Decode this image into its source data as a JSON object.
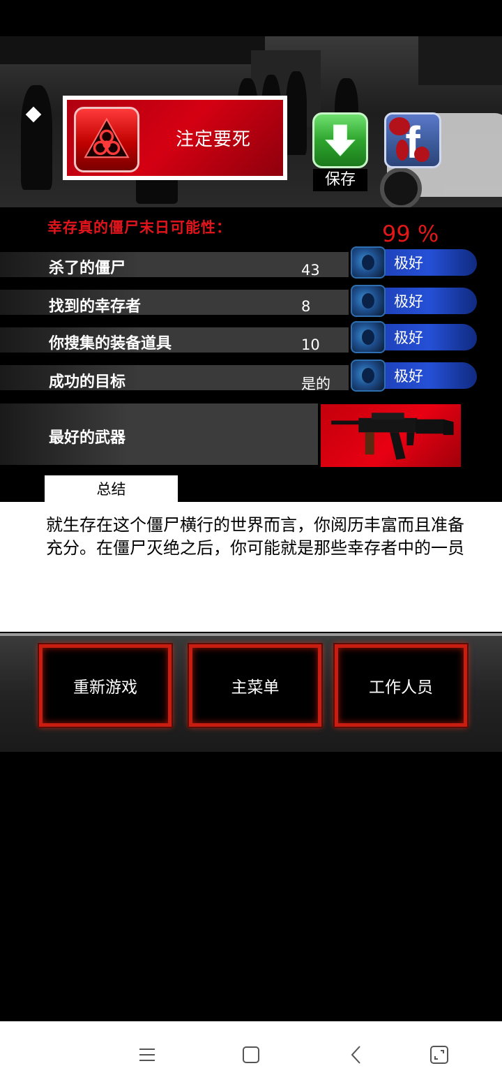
{
  "header": {
    "fate_label": "注定要死",
    "save_label": "保存"
  },
  "stats": {
    "title": "幸存真的僵尸末日可能性：",
    "probability": "99 %",
    "rows": [
      {
        "label": "杀了的僵尸",
        "value": "43",
        "rating": "极好"
      },
      {
        "label": "找到的幸存者",
        "value": "8",
        "rating": "极好"
      },
      {
        "label": "你搜集的装备道具",
        "value": "10",
        "rating": "极好"
      },
      {
        "label": "成功的目标",
        "value": "是的",
        "rating": "极好"
      }
    ],
    "best_weapon_label": "最好的武器"
  },
  "summary": {
    "tab": "总结",
    "text": "就生存在这个僵尸横行的世界而言，你阅历丰富而且准备充分。在僵尸灭绝之后，你可能就是那些幸存者中的一员"
  },
  "menu": {
    "restart": "重新游戏",
    "main_menu": "主菜单",
    "credits": "工作人员"
  },
  "colors": {
    "accent_red": "#e2141c",
    "rating_blue": "#2550d6",
    "save_green": "#2ea52e",
    "facebook_blue": "#3b5998"
  },
  "icons": {
    "fate": "biohazard-icon",
    "save": "download-arrow-icon",
    "share": "facebook-icon",
    "weapon": "assault-rifle-icon",
    "nav": [
      "menu-icon",
      "home-icon",
      "back-icon",
      "recent-apps-icon"
    ]
  }
}
